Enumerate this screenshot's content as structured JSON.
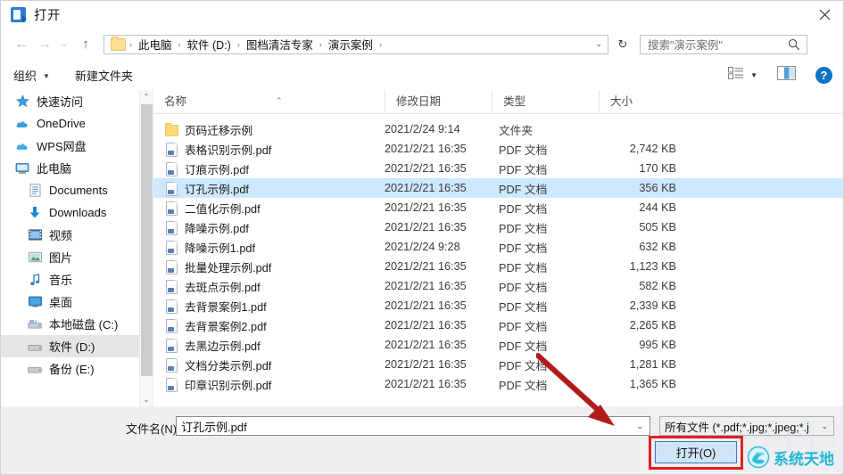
{
  "window": {
    "title": "打开",
    "title_icon": "open-file-icon",
    "close_icon": "close-icon"
  },
  "navigation": {
    "back_icon": "arrow-left-icon",
    "forward_icon": "arrow-right-icon",
    "recent_icon": "chevron-down-icon",
    "up_icon": "arrow-up-icon",
    "folder_icon": "folder-icon",
    "breadcrumbs": [
      "此电脑",
      "软件 (D:)",
      "图档清洁专家",
      "演示案例"
    ],
    "separator": "›",
    "dropdown_caret": "⌄",
    "refresh_icon": "refresh-icon",
    "refresh_glyph": "↻"
  },
  "search": {
    "placeholder": "搜索\"演示案例\"",
    "icon": "search-icon"
  },
  "toolbar": {
    "organize_label": "组织",
    "organize_caret": "▼",
    "new_folder_label": "新建文件夹",
    "view_icon": "view-list-icon",
    "view_caret": "▼",
    "preview_pane_icon": "preview-pane-icon",
    "help_icon": "help-icon",
    "help_glyph": "?"
  },
  "sidebar": {
    "items": [
      {
        "label": "快速访问",
        "icon": "star-icon",
        "level": 0,
        "selected": false
      },
      {
        "label": "OneDrive",
        "icon": "cloud-icon",
        "level": 0,
        "selected": false
      },
      {
        "label": "WPS网盘",
        "icon": "cloud-icon",
        "level": 0,
        "selected": false
      },
      {
        "label": "此电脑",
        "icon": "computer-icon",
        "level": 0,
        "selected": false
      },
      {
        "label": "Documents",
        "icon": "documents-icon",
        "level": 1,
        "selected": false
      },
      {
        "label": "Downloads",
        "icon": "downloads-icon",
        "level": 1,
        "selected": false
      },
      {
        "label": "视频",
        "icon": "video-icon",
        "level": 1,
        "selected": false
      },
      {
        "label": "图片",
        "icon": "pictures-icon",
        "level": 1,
        "selected": false
      },
      {
        "label": "音乐",
        "icon": "music-icon",
        "level": 1,
        "selected": false
      },
      {
        "label": "桌面",
        "icon": "desktop-icon",
        "level": 1,
        "selected": false
      },
      {
        "label": "本地磁盘 (C:)",
        "icon": "drive-icon",
        "level": 1,
        "selected": false
      },
      {
        "label": "软件 (D:)",
        "icon": "drive-icon",
        "level": 1,
        "selected": true
      },
      {
        "label": "备份 (E:)",
        "icon": "drive-icon",
        "level": 1,
        "selected": false
      }
    ],
    "scrollbar": {
      "up_arrow": "⌃",
      "down_arrow": "⌄"
    }
  },
  "filelist": {
    "columns": [
      "名称",
      "修改日期",
      "类型",
      "大小"
    ],
    "sort_indicator": "⌃",
    "rows": [
      {
        "name": "页码迁移示例",
        "date": "2021/2/24 9:14",
        "type": "文件夹",
        "size": "",
        "icon": "folder-icon",
        "selected": false
      },
      {
        "name": "表格识别示例.pdf",
        "date": "2021/2/21 16:35",
        "type": "PDF 文档",
        "size": "2,742 KB",
        "icon": "pdf-icon",
        "selected": false
      },
      {
        "name": "订痕示例.pdf",
        "date": "2021/2/21 16:35",
        "type": "PDF 文档",
        "size": "170 KB",
        "icon": "pdf-icon",
        "selected": false
      },
      {
        "name": "订孔示例.pdf",
        "date": "2021/2/21 16:35",
        "type": "PDF 文档",
        "size": "356 KB",
        "icon": "pdf-icon",
        "selected": true
      },
      {
        "name": "二值化示例.pdf",
        "date": "2021/2/21 16:35",
        "type": "PDF 文档",
        "size": "244 KB",
        "icon": "pdf-icon",
        "selected": false
      },
      {
        "name": "降噪示例.pdf",
        "date": "2021/2/21 16:35",
        "type": "PDF 文档",
        "size": "505 KB",
        "icon": "pdf-icon",
        "selected": false
      },
      {
        "name": "降噪示例1.pdf",
        "date": "2021/2/24 9:28",
        "type": "PDF 文档",
        "size": "632 KB",
        "icon": "pdf-icon",
        "selected": false
      },
      {
        "name": "批量处理示例.pdf",
        "date": "2021/2/21 16:35",
        "type": "PDF 文档",
        "size": "1,123 KB",
        "icon": "pdf-icon",
        "selected": false
      },
      {
        "name": "去斑点示例.pdf",
        "date": "2021/2/21 16:35",
        "type": "PDF 文档",
        "size": "582 KB",
        "icon": "pdf-icon",
        "selected": false
      },
      {
        "name": "去背景案例1.pdf",
        "date": "2021/2/21 16:35",
        "type": "PDF 文档",
        "size": "2,339 KB",
        "icon": "pdf-icon",
        "selected": false
      },
      {
        "name": "去背景案例2.pdf",
        "date": "2021/2/21 16:35",
        "type": "PDF 文档",
        "size": "2,265 KB",
        "icon": "pdf-icon",
        "selected": false
      },
      {
        "name": "去黑边示例.pdf",
        "date": "2021/2/21 16:35",
        "type": "PDF 文档",
        "size": "995 KB",
        "icon": "pdf-icon",
        "selected": false
      },
      {
        "name": "文档分类示例.pdf",
        "date": "2021/2/21 16:35",
        "type": "PDF 文档",
        "size": "1,281 KB",
        "icon": "pdf-icon",
        "selected": false
      },
      {
        "name": "印章识别示例.pdf",
        "date": "2021/2/21 16:35",
        "type": "PDF 文档",
        "size": "1,365 KB",
        "icon": "pdf-icon",
        "selected": false
      }
    ]
  },
  "footer": {
    "filename_label": "文件名(N):",
    "filename_value": "订孔示例.pdf",
    "filename_caret": "⌄",
    "filetype_value": "所有文件 (*.pdf;*.jpg;*.jpeg;*.j",
    "filetype_caret": "⌄",
    "open_button": "打开(O)"
  },
  "annotations": {
    "arrow_color": "#b01a1a",
    "highlight_color": "#e02020"
  },
  "watermark": {
    "text": "系统天地",
    "icon": "globe-icon",
    "color": "#1eb7d6"
  }
}
